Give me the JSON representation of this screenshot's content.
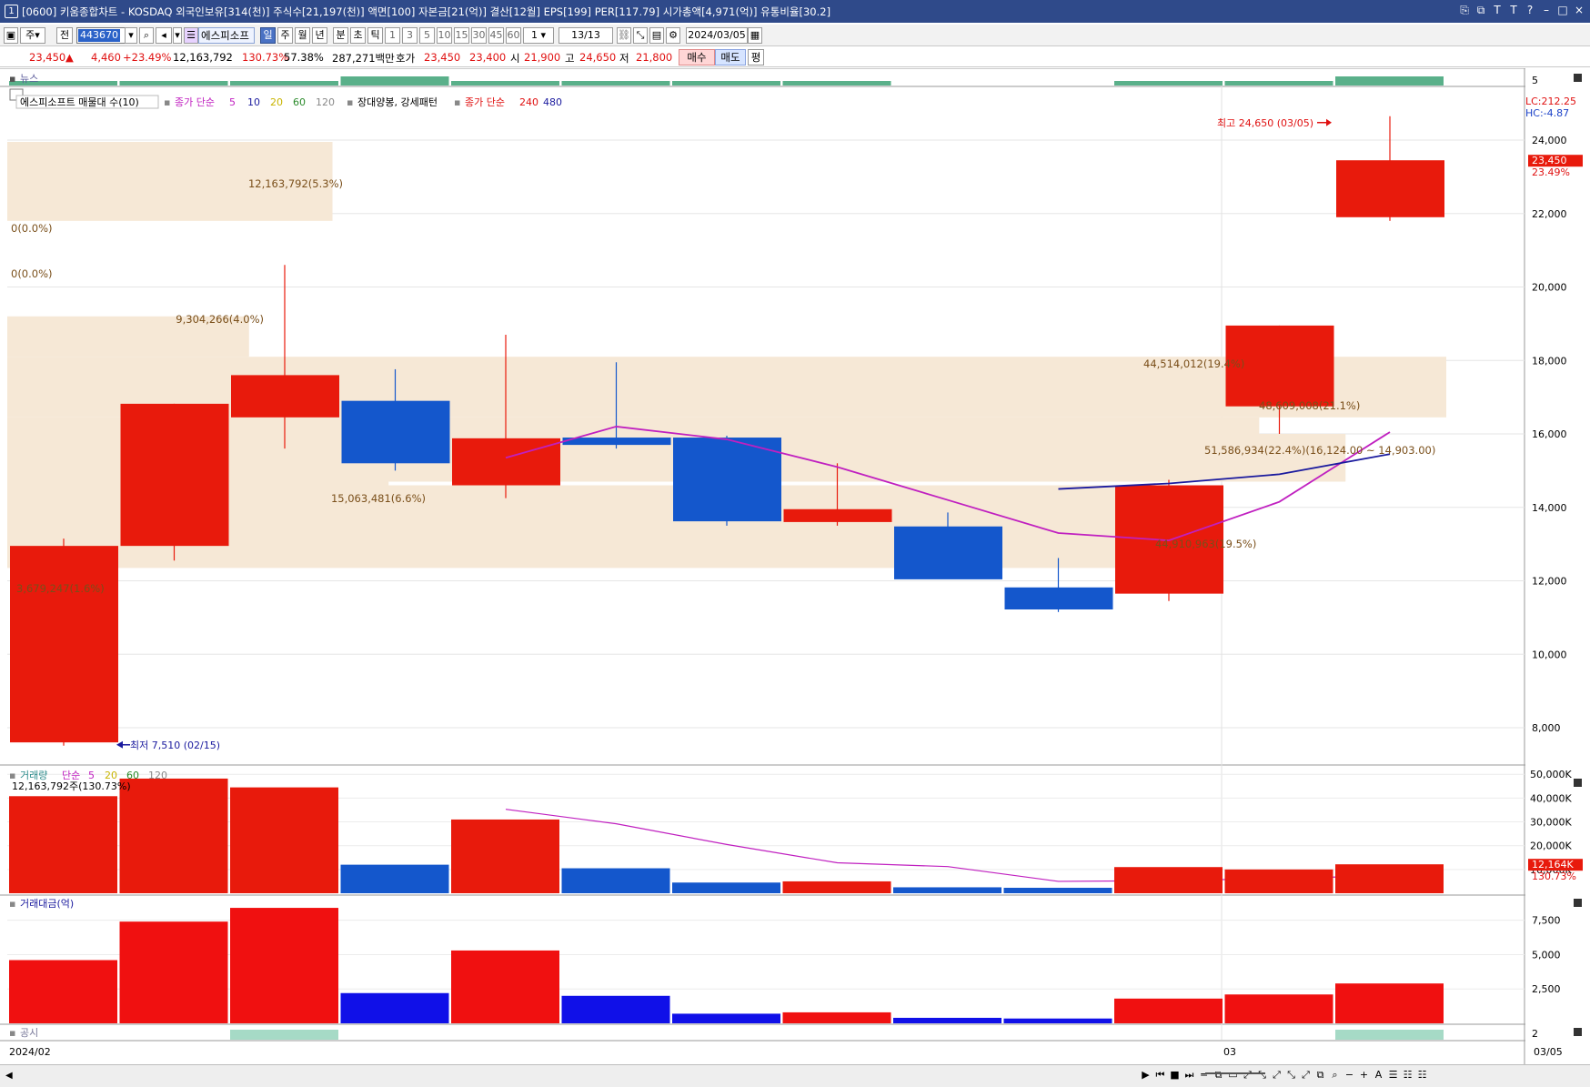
{
  "window": {
    "number": "1",
    "title": "[0600] 키움종합차트 - KOSDAQ 외국인보유[314(천)] 주식수[21,197(천)] 액면[100] 자본금[21(억)] 결산[12월] EPS[199] PER[117.79] 시가총액[4,971(억)] 유통비율[30.2]",
    "icons": [
      "restore-icon",
      "tile-icon",
      "font-icon",
      "text-icon",
      "help-icon",
      "minimize-icon",
      "maximize-icon",
      "close-icon"
    ],
    "icon_glyphs": [
      "⎘",
      "⧉",
      "T",
      "T",
      "?",
      "–",
      "□",
      "×"
    ]
  },
  "toolbar": {
    "type_label": "주",
    "prev_label": "전",
    "stock_code": "443670",
    "stock_name": "에스피소프",
    "periods": [
      "일",
      "주",
      "월",
      "년",
      "분",
      "초",
      "틱"
    ],
    "selected_period": "일",
    "intervals": [
      "1",
      "3",
      "5",
      "10",
      "15",
      "30",
      "45",
      "60"
    ],
    "count_value": "1",
    "range": "13/13",
    "date": "2024/03/05"
  },
  "quote": {
    "price": "23,450",
    "up_arrow": "▲",
    "change": "4,460",
    "change_pct": "+23.49%",
    "volume": "12,163,792",
    "vol_ratio": "130.73%",
    "turnover": "57.38%",
    "amount": "287,271백만",
    "ask_label": "호가",
    "ask": "23,450",
    "bid": "23,400",
    "open_label": "시",
    "open": "21,900",
    "high_label": "고",
    "high": "24,650",
    "low_label": "저",
    "low": "21,800",
    "buy_label": "매수",
    "sell_label": "매도",
    "avg_label": "평"
  },
  "panels": {
    "news_label": "뉴스",
    "news_axis": "5",
    "price_axis_ticks": [
      "24,000",
      "22,000",
      "20,000",
      "18,000",
      "16,000",
      "14,000",
      "12,000",
      "10,000",
      "8,000"
    ],
    "lc": "LC:212.25",
    "hc": "HC:-4.87",
    "current_price_tag": "23,450",
    "current_pct_tag": "23.49%",
    "volume_axis_ticks": [
      "50,000K",
      "40,000K",
      "30,000K",
      "20,000K",
      "10,000K"
    ],
    "volume_tag": "12,164K",
    "volume_pct_tag": "130.73%",
    "amount_label": "거래대금(억)",
    "amount_axis_ticks": [
      "7,500",
      "5,000",
      "2,500"
    ],
    "disclosure_label": "공시",
    "disclosure_axis": "2",
    "date_left": "2024/02",
    "date_mid": "03",
    "date_right": "03/05"
  },
  "legend": {
    "price_title": "에스피소프트 매물대 수(10)",
    "ma_label": "종가 단순",
    "ma_periods": [
      "5",
      "10",
      "20",
      "60",
      "120"
    ],
    "ma_colors": [
      "#c020c0",
      "#1a1a9e",
      "#c8b400",
      "#2a8a2a",
      "#888888"
    ],
    "pattern": "장대양봉, 강세패턴",
    "ma2_label": "종가 단순",
    "ma2_periods": [
      "240",
      "480"
    ],
    "volume_title": "거래량",
    "volume_ma_label": "단순",
    "volume_ma_periods": [
      "5",
      "20",
      "60",
      "120"
    ],
    "volume_current": "12,163,792주(130.73%)"
  },
  "annotations": {
    "high": "최고 24,650 (03/05)",
    "low": "최저 7,510 (02/15)"
  },
  "volume_profile": [
    {
      "label": "12,163,792(5.3%)"
    },
    {
      "label": "0(0.0%)"
    },
    {
      "label": "0(0.0%)"
    },
    {
      "label": "9,304,266(4.0%)"
    },
    {
      "label": "44,514,012(19.4%)"
    },
    {
      "label": "48,609,008(21.1%)"
    },
    {
      "label": "51,586,934(22.4%)(16,124.00 ~ 14,903.00)"
    },
    {
      "label": "15,063,481(6.6%)"
    },
    {
      "label": "44,910,963(19.5%)"
    },
    {
      "label": "3,679,247(1.6%)"
    }
  ],
  "colors": {
    "up": "#e81a0c",
    "down": "#1457cc",
    "amount_up": "#f01010",
    "amount_down": "#1010e8",
    "profile": "#f6e8d6",
    "ma5": "#c020c0",
    "ma10": "#1a1a9e",
    "news": "#5ab08a",
    "disclosure": "#a6dac6"
  },
  "chart_data": {
    "type": "candlestick",
    "candles": [
      {
        "open": 7600,
        "high": 13150,
        "low": 7510,
        "close": 12950,
        "dir": "up"
      },
      {
        "open": 12950,
        "high": 16820,
        "low": 12550,
        "close": 16820,
        "dir": "up"
      },
      {
        "open": 16450,
        "high": 20600,
        "low": 15600,
        "close": 17600,
        "dir": "up"
      },
      {
        "open": 16900,
        "high": 17760,
        "low": 15000,
        "close": 15200,
        "dir": "down"
      },
      {
        "open": 14600,
        "high": 18700,
        "low": 14250,
        "close": 15880,
        "dir": "up"
      },
      {
        "open": 15900,
        "high": 17950,
        "low": 15600,
        "close": 15700,
        "dir": "down"
      },
      {
        "open": 15900,
        "high": 15950,
        "low": 13500,
        "close": 13620,
        "dir": "down"
      },
      {
        "open": 13600,
        "high": 15200,
        "low": 13500,
        "close": 13950,
        "dir": "up"
      },
      {
        "open": 13480,
        "high": 13860,
        "low": 12050,
        "close": 12040,
        "dir": "down"
      },
      {
        "open": 11820,
        "high": 12620,
        "low": 11150,
        "close": 11220,
        "dir": "down"
      },
      {
        "open": 11650,
        "high": 14750,
        "low": 11450,
        "close": 14600,
        "dir": "up"
      },
      {
        "open": 16750,
        "high": 18950,
        "low": 16000,
        "close": 18950,
        "dir": "up"
      },
      {
        "open": 21900,
        "high": 24650,
        "low": 21800,
        "close": 23450,
        "dir": "up"
      }
    ],
    "ma5": [
      null,
      null,
      null,
      null,
      15350,
      16200,
      15850,
      15100,
      14200,
      13300,
      13100,
      14150,
      16050
    ],
    "ma10": [
      null,
      null,
      null,
      null,
      null,
      null,
      null,
      null,
      null,
      14500,
      14650,
      14900,
      15450
    ],
    "volume_k": [
      40800,
      48200,
      44500,
      12000,
      31000,
      10500,
      4500,
      5000,
      2500,
      2300,
      11000,
      10000,
      12164
    ],
    "volume_ma": [
      null,
      null,
      null,
      null,
      35300,
      29200,
      20500,
      12800,
      11200,
      5000,
      5300,
      6200,
      7400
    ],
    "amount": [
      4600,
      7400,
      8400,
      2200,
      5300,
      2000,
      700,
      800,
      400,
      350,
      1800,
      2100,
      2900
    ],
    "news": [
      1,
      1,
      1,
      2,
      1,
      1,
      1,
      1,
      0,
      0,
      1,
      1,
      2
    ],
    "disclosure": [
      0,
      0,
      1,
      0,
      0,
      0,
      0,
      0,
      0,
      0,
      0,
      0,
      1
    ],
    "profile": [
      {
        "from": 21800,
        "to": 23950,
        "extent": 0.226
      },
      {
        "from": 18100,
        "to": 19200,
        "extent": 0.168
      },
      {
        "from": 16450,
        "to": 18100,
        "extent": 1.0
      },
      {
        "from": 15000,
        "to": 16450,
        "extent": 0.87
      },
      {
        "from": 14700,
        "to": 16000,
        "extent": 0.93
      },
      {
        "from": 12350,
        "to": 14600,
        "extent": 0.81
      },
      {
        "from": 13600,
        "to": 14700,
        "extent": 0.265
      }
    ],
    "price_range": [
      7000,
      25800
    ],
    "volume_range": [
      0,
      52000
    ],
    "amount_range": [
      0,
      9000
    ]
  }
}
